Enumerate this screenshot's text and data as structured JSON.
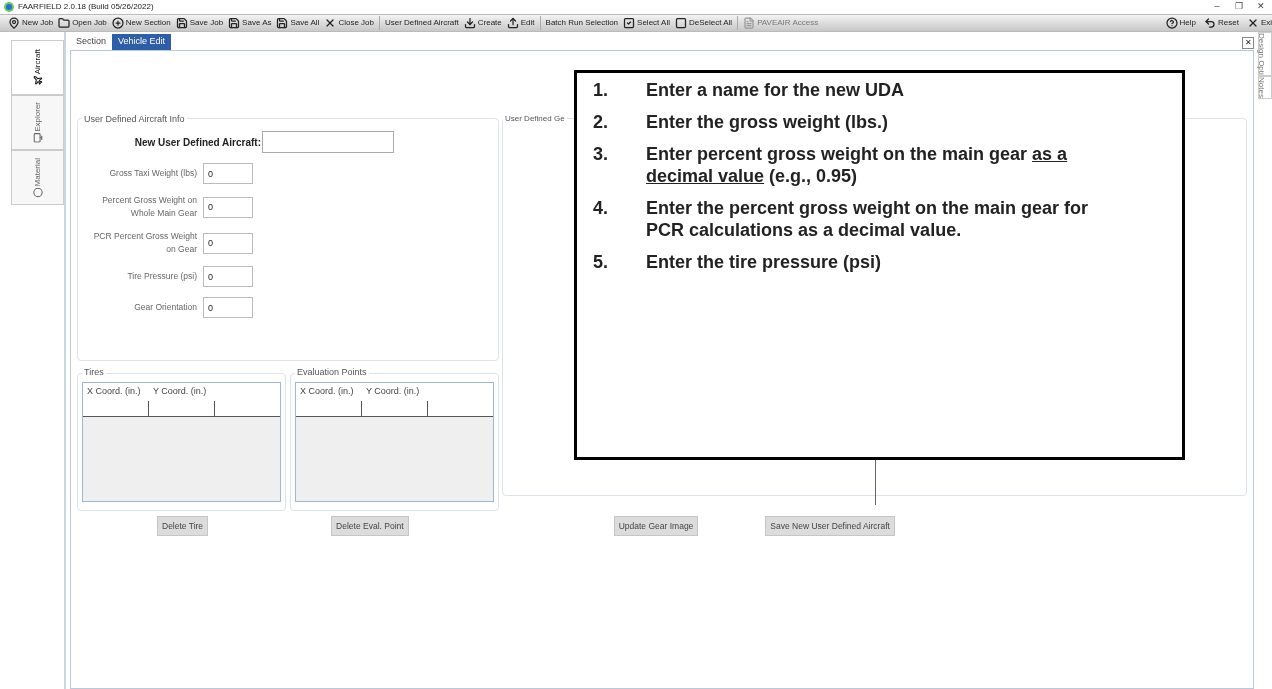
{
  "window": {
    "title": "FAARFIELD 2.0.18 (Build 05/26/2022)",
    "controls": [
      "–",
      "❐",
      "✕"
    ]
  },
  "toolbar": {
    "items": [
      {
        "kind": "button",
        "label": "New Job"
      },
      {
        "kind": "button",
        "label": "Open Job"
      },
      {
        "kind": "button",
        "label": "New Section"
      },
      {
        "kind": "button",
        "label": "Save Job"
      },
      {
        "kind": "button",
        "label": "Save As"
      },
      {
        "kind": "button",
        "label": "Save All"
      },
      {
        "kind": "button",
        "label": "Close Job"
      },
      {
        "kind": "separator"
      },
      {
        "kind": "label",
        "label": "User Defined Aircraft"
      },
      {
        "kind": "button",
        "label": "Create"
      },
      {
        "kind": "button",
        "label": "Edit"
      },
      {
        "kind": "separator"
      },
      {
        "kind": "label",
        "label": "Batch Run Selection"
      },
      {
        "kind": "button",
        "label": "Select All"
      },
      {
        "kind": "button",
        "label": "DeSelect All"
      },
      {
        "kind": "separator"
      },
      {
        "kind": "disabled",
        "label": "PAVEAIR Access"
      }
    ],
    "right": [
      {
        "label": "Help"
      },
      {
        "label": "Reset"
      },
      {
        "label": "Exi"
      }
    ]
  },
  "left_tabs": [
    {
      "label": "Aircraft",
      "selected": true
    },
    {
      "label": "Explorer",
      "selected": false
    },
    {
      "label": "Material",
      "selected": false
    }
  ],
  "right_tabs": [
    {
      "label": "Design Opti"
    },
    {
      "label": "Notes"
    }
  ],
  "tabs": [
    {
      "label": "Section",
      "selected": false
    },
    {
      "label": "Vehicle Edit",
      "selected": true
    }
  ],
  "close_button": "✕",
  "info": {
    "title": "User Defined Aircraft Info",
    "name_label": "New User Defined Aircraft:",
    "fields": [
      {
        "label": "Gross Taxi Weight (lbs)",
        "value": "0"
      },
      {
        "label": "Percent Gross Weight on Whole Main Gear",
        "value": "0"
      },
      {
        "label": "PCR Percent Gross Weight on Gear",
        "value": "0"
      },
      {
        "label": "Tire Pressure (psi)",
        "value": "0"
      },
      {
        "label": "Gear Orientation",
        "value": "0"
      }
    ]
  },
  "gear_group": {
    "title": "User Defined Ge"
  },
  "tires": {
    "title": "Tires",
    "columns": [
      "X Coord. (in.)",
      "Y Coord. (in.)"
    ]
  },
  "evaluation_points": {
    "title": "Evaluation Points",
    "columns": [
      "X Coord. (in.)",
      "Y Coord. (in.)"
    ]
  },
  "buttons": [
    "Delete Tire",
    "Delete Eval. Point",
    "Update Gear Image",
    "Save New User Defined Aircraft"
  ],
  "callout": {
    "items": [
      {
        "number": "1.",
        "parts": [
          {
            "text": "Enter a name for the new UDA",
            "underline": false
          }
        ]
      },
      {
        "number": "2.",
        "parts": [
          {
            "text": "Enter the gross weight (lbs.)",
            "underline": false
          }
        ]
      },
      {
        "number": "3.",
        "parts": [
          {
            "text": "Enter percent gross weight on the main gear ",
            "underline": false
          },
          {
            "text": "as a decimal value",
            "underline": true
          },
          {
            "text": " (e.g., 0.95)",
            "underline": false
          }
        ]
      },
      {
        "number": "4.",
        "parts": [
          {
            "text": "Enter the percent gross weight on the main gear for PCR calculations as a decimal value.",
            "underline": false
          }
        ]
      },
      {
        "number": "5.",
        "parts": [
          {
            "text": "Enter the tire pressure (psi)",
            "underline": false
          }
        ]
      }
    ]
  }
}
